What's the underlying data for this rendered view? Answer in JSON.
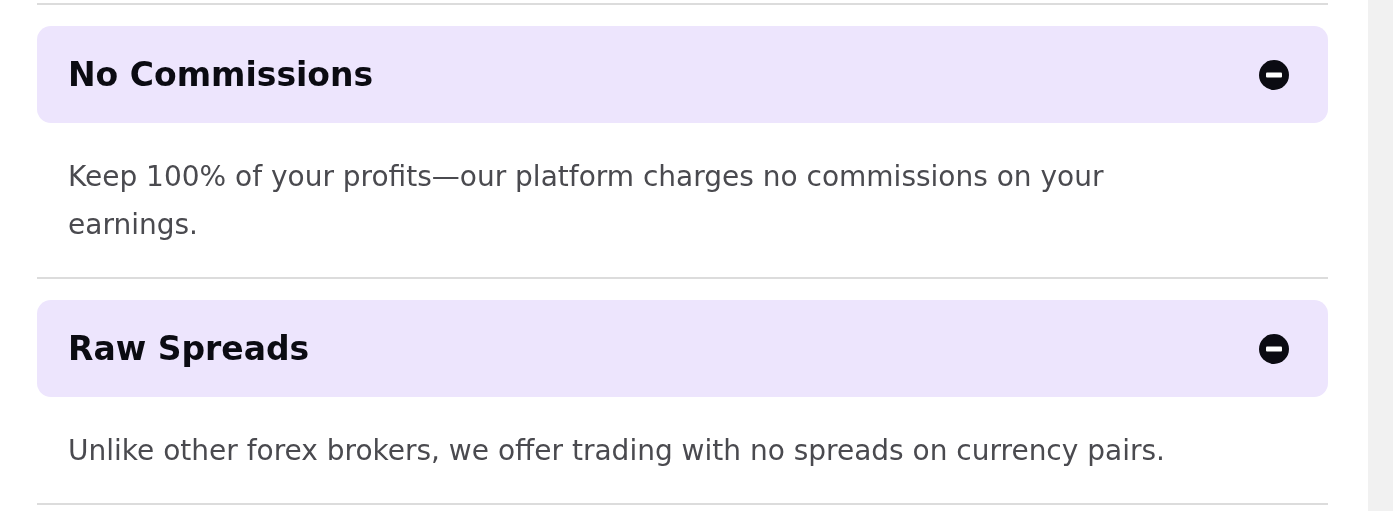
{
  "faq": [
    {
      "title": "No Commissions",
      "expanded": true,
      "answer": "Keep 100% of your profits—our platform charges no commissions on your earnings."
    },
    {
      "title": "Raw Spreads",
      "expanded": true,
      "answer": "Unlike other forex brokers, we offer trading with no spreads on currency pairs."
    }
  ]
}
